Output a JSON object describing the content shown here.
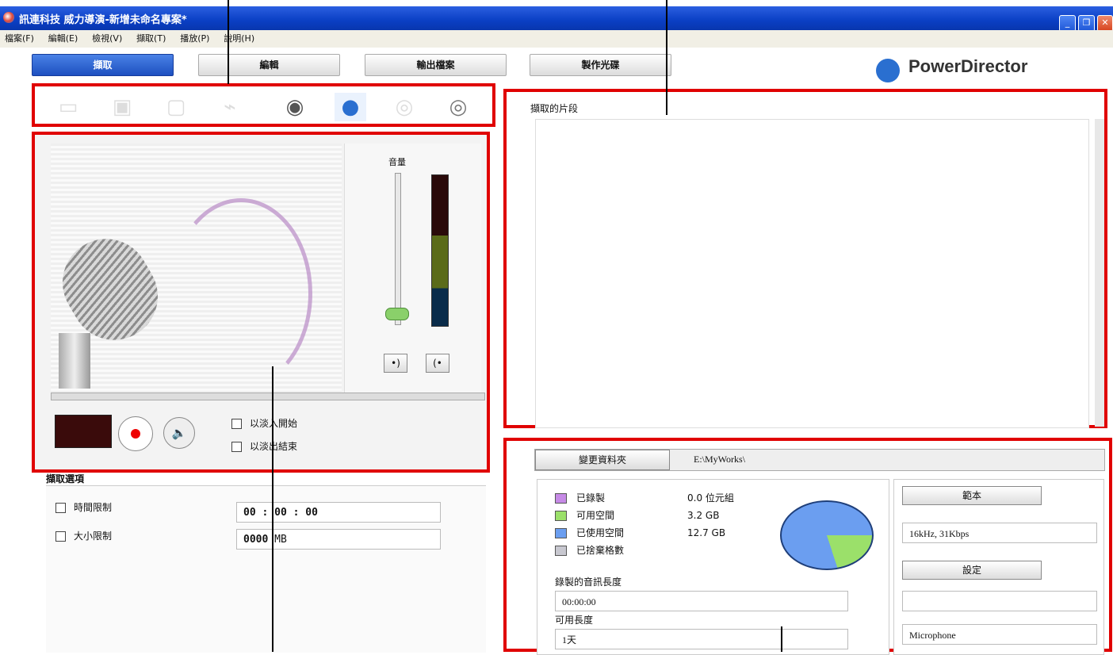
{
  "window": {
    "title": "訊連科技 威力導演-新增未命名專案*"
  },
  "menu": [
    "檔案(F)",
    "編輯(E)",
    "檢視(V)",
    "擷取(T)",
    "播放(P)",
    "說明(H)"
  ],
  "nav": {
    "capture": "擷取",
    "edit": "編輯",
    "produce": "輸出檔案",
    "disc": "製作光碟"
  },
  "brand": {
    "name": "PowerDirector"
  },
  "devices": [
    "dv-camcorder-icon",
    "hdv-camcorder-icon",
    "tv-icon",
    "digital-tv-icon",
    "webcam-icon",
    "microphone-icon",
    "cd-audio-icon",
    "dvd-icon"
  ],
  "recorder": {
    "volume_label": "音量",
    "fade_in_label": "以淡入開始",
    "fade_out_label": "以淡出結束"
  },
  "options": {
    "header": "擷取選項",
    "time_limit_label": "時間限制",
    "time_limit_value": "00 : 00 : 00",
    "size_limit_label": "大小限制",
    "size_limit_value": "0000",
    "size_unit": "MB"
  },
  "clips": {
    "title": "擷取的片段"
  },
  "info": {
    "change_folder": "變更資料夾",
    "folder_path": "E:\\MyWorks\\",
    "recorded_label": "已錄製",
    "recorded_value": "0.0 位元組",
    "free_label": "可用空間",
    "free_value": "3.2 GB",
    "used_label": "已使用空間",
    "used_value": "12.7 GB",
    "dropped_label": "已捨棄格數",
    "duration_label": "錄製的音訊長度",
    "duration_value": "00:00:00",
    "available_label": "可用長度",
    "available_value": "1天",
    "profile_button": "範本",
    "profile_value": "16kHz,  31Kbps",
    "settings_button": "設定",
    "device_value": "Microphone",
    "pie": {
      "free_fraction": 0.2,
      "used_fraction": 0.8
    }
  },
  "colors": {
    "accent": "#1d4fc0",
    "highlight": "#e00000",
    "recorded": "#c68ae6",
    "free": "#9be06a",
    "used": "#6b9ef0",
    "dropped": "#c8c8d0"
  }
}
